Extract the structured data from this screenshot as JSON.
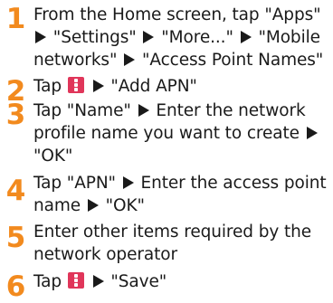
{
  "steps": [
    {
      "number": "1",
      "lines": [
        [
          "From the Home screen, tap \"Apps\""
        ],
        [
          "",
          "\"Settings\"",
          "\"More...\"",
          "\"Mobile"
        ],
        [
          "networks\"",
          "\"Access Point Names\""
        ]
      ]
    },
    {
      "number": "2",
      "tap": "Tap",
      "after_icon": "\"Add APN\""
    },
    {
      "number": "3",
      "lines": [
        [
          "Tap \"Name\"",
          "Enter the network"
        ],
        [
          "profile name you want to create"
        ],
        [
          "\"OK\""
        ]
      ]
    },
    {
      "number": "4",
      "lines": [
        [
          "Tap \"APN\"",
          "Enter the access point"
        ],
        [
          "name",
          "\"OK\""
        ]
      ]
    },
    {
      "number": "5",
      "lines": [
        [
          "Enter other items required by the"
        ],
        [
          "network operator"
        ]
      ]
    },
    {
      "number": "6",
      "tap": "Tap",
      "after_icon": "\"Save\""
    }
  ],
  "colors": {
    "step_number": "#f28a1e",
    "menu_icon": "#e0365a",
    "text": "#1a1a1a"
  },
  "icons": {
    "arrow": "triangle-right-icon",
    "menu": "menu-dots-icon"
  }
}
